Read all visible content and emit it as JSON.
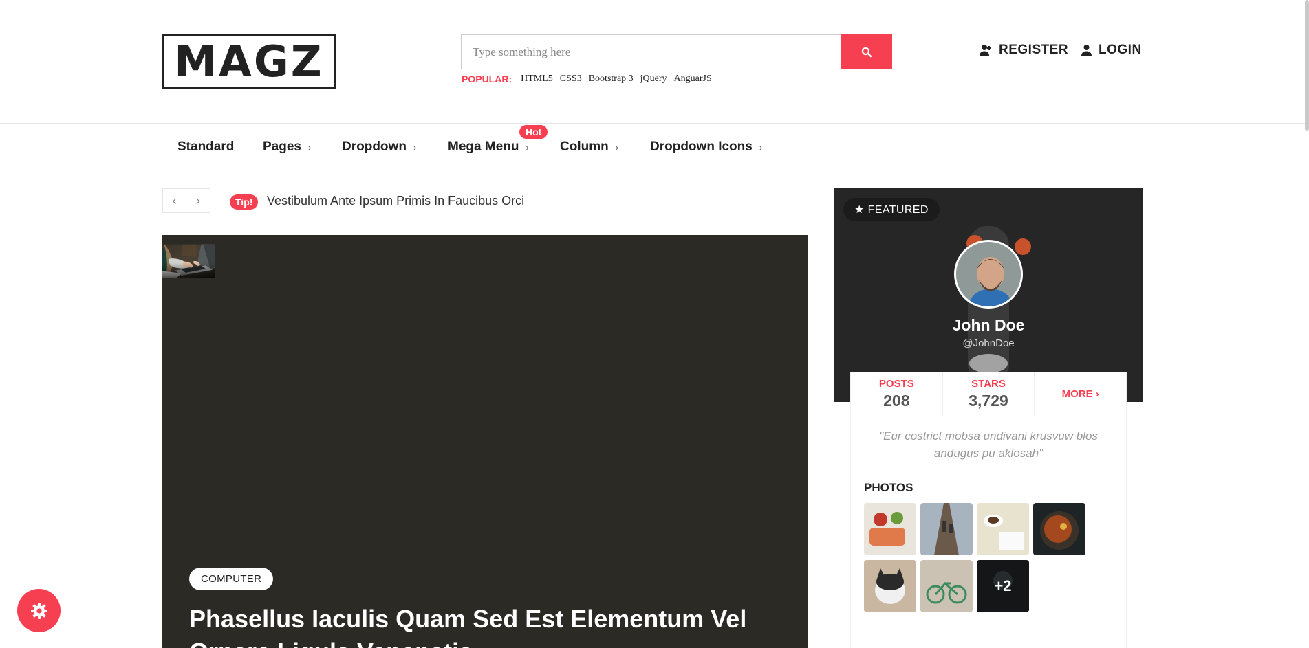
{
  "header": {
    "logo": "MAGZ",
    "search": {
      "placeholder": "Type something here"
    },
    "popular_label": "POPULAR:",
    "popular_tags": [
      "HTML5",
      "CSS3",
      "Bootstrap 3",
      "jQuery",
      "AnguarJS"
    ],
    "register_label": "REGISTER",
    "login_label": "LOGIN"
  },
  "nav": {
    "items": [
      {
        "label": "Standard",
        "chevron": ""
      },
      {
        "label": "Pages",
        "chevron": "›"
      },
      {
        "label": "Dropdown",
        "chevron": "›"
      },
      {
        "label": "Mega Menu",
        "chevron": "›"
      },
      {
        "label": "Column",
        "chevron": "›"
      },
      {
        "label": "Dropdown Icons",
        "chevron": "›"
      }
    ],
    "hot_badge": "Hot"
  },
  "ticker": {
    "prev": "‹",
    "next": "›",
    "badge": "Tip!",
    "text": "Vestibulum Ante Ipsum Primis In Faucibus Orci"
  },
  "hero": {
    "category": "COMPUTER",
    "title": "Phasellus Iaculis Quam Sed Est Elementum Vel Ornare Ligula Venenatis"
  },
  "featured": {
    "badge": "★ FEATURED",
    "name": "John Doe",
    "handle": "@JohnDoe",
    "stats": [
      {
        "label": "POSTS",
        "value": "208"
      },
      {
        "label": "STARS",
        "value": "3,729"
      }
    ],
    "more": "MORE ›",
    "quote": "\"Eur costrict mobsa undivani krusvuw blos andugus pu aklosah\"",
    "photos_title": "PHOTOS",
    "photos_more": "+2"
  },
  "colors": {
    "accent": "#f73f52",
    "text": "#222222"
  },
  "icons": [
    "search-icon",
    "user-plus-icon",
    "user-icon",
    "chevron-right-icon",
    "chevron-left-icon",
    "star-icon",
    "gear-icon"
  ]
}
